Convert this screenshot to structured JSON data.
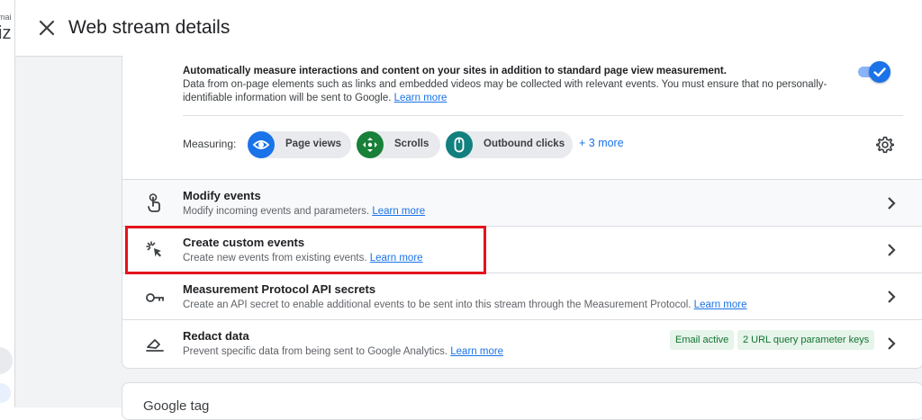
{
  "background": {
    "partial_text_top": "mai",
    "partial_text_large": "iz"
  },
  "header": {
    "title": "Web stream details",
    "close_icon": "close-icon"
  },
  "enhanced_measurement": {
    "description_bold": "Automatically measure interactions and content on your sites in addition to standard page view measurement.",
    "description": "Data from on-page elements such as links and embedded videos may be collected with relevant events. You must ensure that no personally-identifiable information will be sent to Google.",
    "learn_more": "Learn more",
    "toggle_on": true,
    "measuring_label": "Measuring:",
    "chips": [
      {
        "label": "Page views",
        "icon": "eye-icon",
        "color": "#1a73e8"
      },
      {
        "label": "Scrolls",
        "icon": "scroll-arrows-icon",
        "color": "#188038"
      },
      {
        "label": "Outbound clicks",
        "icon": "mouse-icon",
        "color": "#12807f"
      }
    ],
    "more_label": "+ 3 more"
  },
  "rows": [
    {
      "title": "Modify events",
      "description": "Modify incoming events and parameters.",
      "learn_more": "Learn more",
      "icon": "touch-hand-icon"
    },
    {
      "title": "Create custom events",
      "description": "Create new events from existing events.",
      "learn_more": "Learn more",
      "icon": "sparkle-cursor-icon"
    },
    {
      "title": "Measurement Protocol API secrets",
      "description": "Create an API secret to enable additional events to be sent into this stream through the Measurement Protocol.",
      "learn_more": "Learn more",
      "icon": "key-icon"
    },
    {
      "title": "Redact data",
      "description": "Prevent specific data from being sent to Google Analytics.",
      "learn_more": "Learn more",
      "icon": "eraser-icon",
      "badges": [
        "Email active",
        "2 URL query parameter keys"
      ]
    }
  ],
  "google_tag": {
    "title": "Google tag"
  },
  "colors": {
    "accent": "#1a73e8",
    "highlight_border": "#e3141d",
    "badge_bg": "#e6f4ea",
    "badge_text": "#137333"
  }
}
